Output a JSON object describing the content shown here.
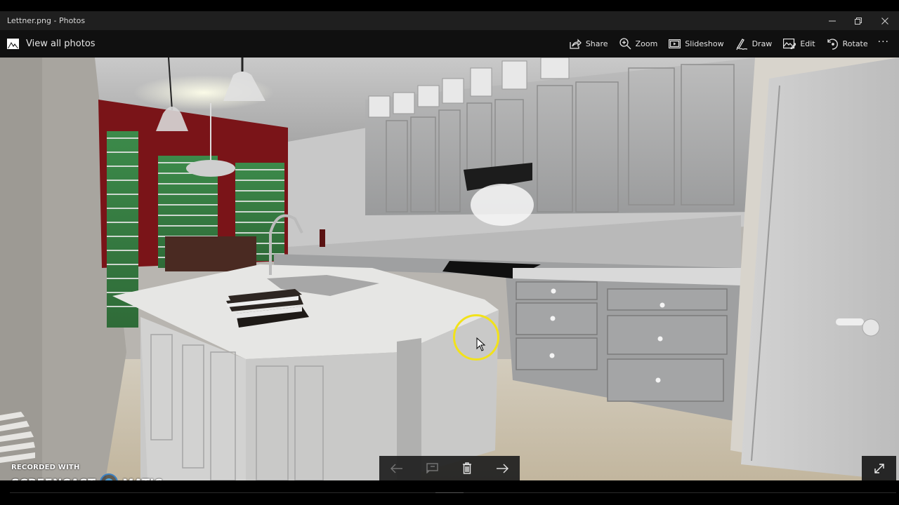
{
  "window": {
    "title": "Lettner.png - Photos",
    "controls": {
      "minimize": "minimize-icon",
      "maximize": "restore-icon",
      "close": "close-icon"
    }
  },
  "toolbar": {
    "view_all_label": "View all photos",
    "view_all_icon": "photos-icon",
    "actions": [
      {
        "label": "Share",
        "icon": "share-icon"
      },
      {
        "label": "Zoom",
        "icon": "zoom-in-icon"
      },
      {
        "label": "Slideshow",
        "icon": "slideshow-icon"
      },
      {
        "label": "Draw",
        "icon": "pen-icon"
      },
      {
        "label": "Edit",
        "icon": "edit-photo-icon"
      },
      {
        "label": "Rotate",
        "icon": "rotate-icon"
      }
    ],
    "more_label": "···"
  },
  "photo": {
    "description": "3D rendered kitchen interior with white cabinetry, island with sink and stacked books, red accent wall with shuttered windows",
    "colors": {
      "accent_wall": "#7a1418",
      "cabinet": "#a9aaab",
      "floor": "#c9bea8",
      "countertop": "#e6e6e4"
    }
  },
  "nav_controls": {
    "previous": "arrow-left-icon",
    "compare": "compare-icon",
    "delete": "trash-icon",
    "next": "arrow-right-icon"
  },
  "fullscreen": "expand-icon",
  "cursor": {
    "highlight_color": "#f2e21a"
  },
  "watermark": {
    "line1": "RECORDED WITH",
    "brand_left": "SCREENCAST",
    "brand_right": "MATIC",
    "logo_color": "#4da3e0"
  }
}
